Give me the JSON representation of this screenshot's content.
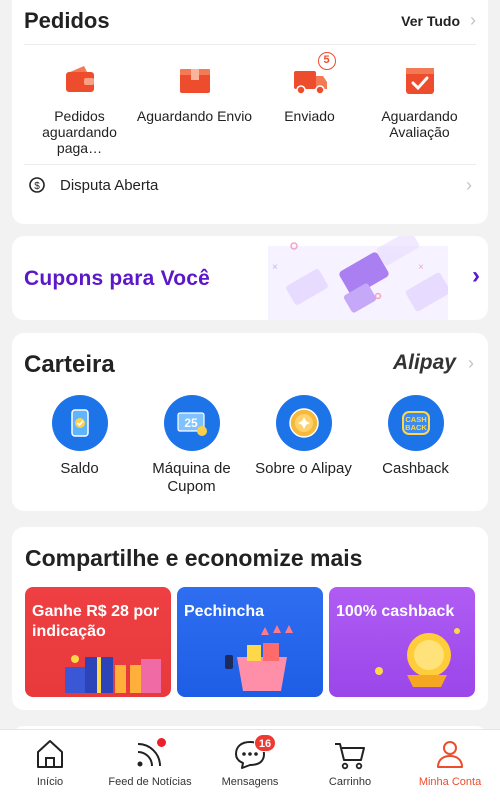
{
  "orders": {
    "title": "Pedidos",
    "see_all": "Ver Tudo",
    "items": [
      {
        "label": "Pedidos aguardando paga…",
        "icon": "wallet-icon"
      },
      {
        "label": "Aguardando Envio",
        "icon": "package-icon"
      },
      {
        "label": "Enviado",
        "icon": "truck-icon",
        "badge": "5"
      },
      {
        "label": "Aguardando Avaliação",
        "icon": "review-icon"
      }
    ],
    "dispute": "Disputa Aberta"
  },
  "coupons": {
    "title": "Cupons para Você"
  },
  "wallet": {
    "title": "Carteira",
    "brand": "Alipay",
    "items": [
      {
        "label": "Saldo",
        "icon": "balance-phone-icon"
      },
      {
        "label": "Máquina de Cupom",
        "icon": "coupon-machine-icon",
        "icon_text": "25"
      },
      {
        "label": "Sobre o Alipay",
        "icon": "coin-icon"
      },
      {
        "label": "Cashback",
        "icon": "cashback-icon",
        "icon_text_1": "CASH",
        "icon_text_2": "BACK"
      }
    ]
  },
  "share": {
    "title": "Compartilhe e economize mais",
    "promos": [
      {
        "label": "Ganhe R$ 28 por indicação",
        "color": "#ee3f43"
      },
      {
        "label": "Pechincha",
        "color": "#2f6ef0"
      },
      {
        "label": "100% cashback",
        "color": "#a650ef"
      }
    ]
  },
  "nav": {
    "items": [
      {
        "label": "Início",
        "icon": "home-icon"
      },
      {
        "label": "Feed de Notícias",
        "icon": "feed-icon"
      },
      {
        "label": "Mensagens",
        "icon": "messages-icon",
        "badge": "16"
      },
      {
        "label": "Carrinho",
        "icon": "cart-icon"
      },
      {
        "label": "Minha Conta",
        "icon": "account-icon"
      }
    ],
    "accent": "#ee4d2d"
  }
}
